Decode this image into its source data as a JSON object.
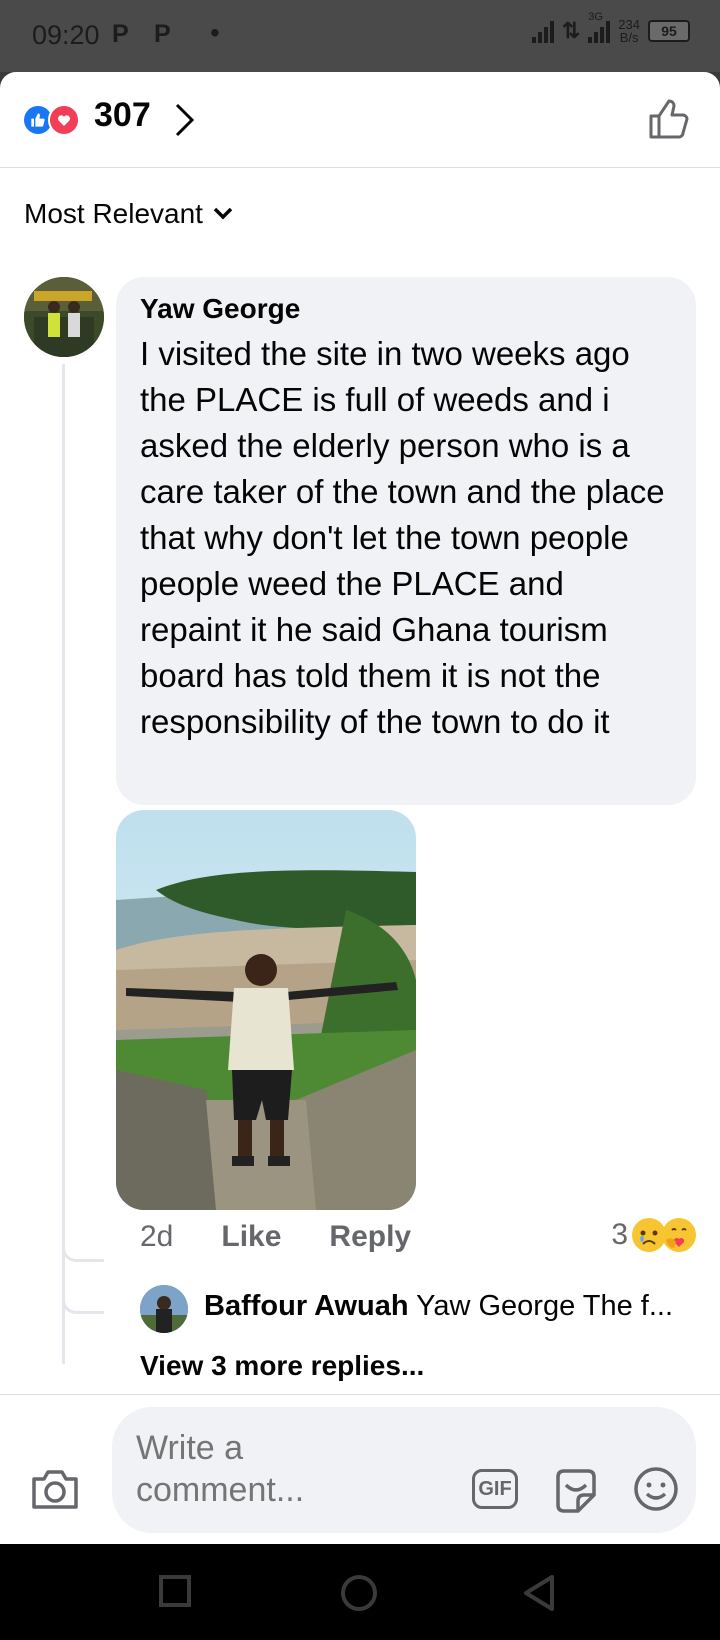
{
  "status_bar": {
    "time": "09:20",
    "notif_1": "P",
    "notif_2": "P",
    "network": "3G",
    "speed_value": "234",
    "speed_unit": "B/s",
    "battery": "95"
  },
  "reactions": {
    "count": "307",
    "types": [
      "like-icon",
      "love-icon"
    ]
  },
  "sort": {
    "label": "Most Relevant"
  },
  "comment": {
    "author": "Yaw George",
    "text": "I visited the site in two weeks ago the PLACE is full of weeds and i asked the elderly person who is a care taker of the town and the place that why don't let the town people people weed the PLACE and repaint it he said Ghana tourism board has told them it is not the responsibility of the town to do it",
    "time": "2d",
    "like_label": "Like",
    "reply_label": "Reply",
    "reaction_count": "3"
  },
  "reply_preview": {
    "name": "Baffour Awuah",
    "text": "Yaw George The f..."
  },
  "more_replies": "View 3 more replies...",
  "composer": {
    "placeholder": "Write a comment...",
    "gif_label": "GIF"
  },
  "colors": {
    "facebook_blue": "#1877f2",
    "love_red": "#f33e58",
    "bubble_bg": "#f0f2f5",
    "secondary_text": "#65676b"
  }
}
